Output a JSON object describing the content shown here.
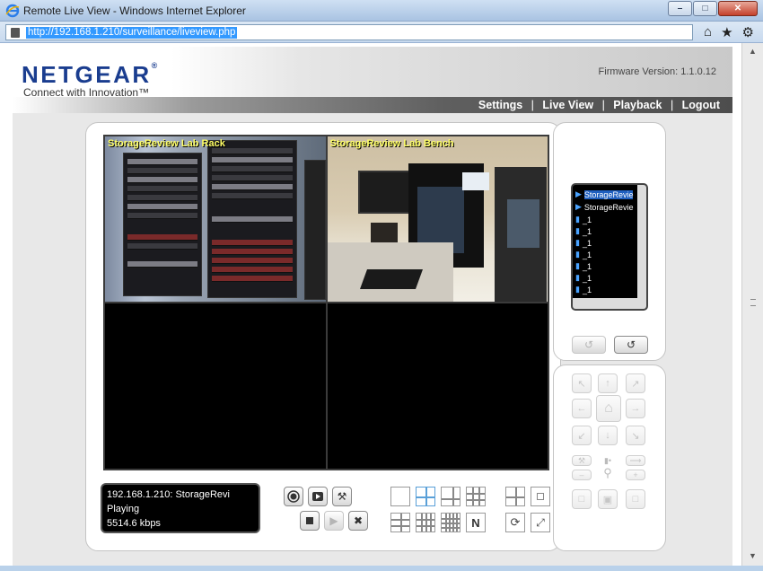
{
  "window": {
    "title": "Remote Live View - Windows Internet Explorer",
    "url": "http://192.168.1.210/surveillance/liveview.php"
  },
  "header": {
    "logo_text": "NETGEAR",
    "tagline": "Connect with Innovation™",
    "firmware": "Firmware Version: 1.1.0.12"
  },
  "nav": {
    "items": [
      "Settings",
      "Live View",
      "Playback",
      "Logout"
    ],
    "separator": "|"
  },
  "video": {
    "tiles": [
      {
        "label": "StorageReview Lab Rack",
        "state": "playing"
      },
      {
        "label": "StorageReview Lab Bench",
        "state": "playing"
      },
      {
        "label": "",
        "state": "empty"
      },
      {
        "label": "",
        "state": "empty"
      }
    ]
  },
  "status": {
    "line1": "192.168.1.210: StorageRevi",
    "line2": "Playing",
    "line3": "5514.6 kbps"
  },
  "camera_list": {
    "items": [
      {
        "label": "StorageRevie",
        "selected": true
      },
      {
        "label": "StorageRevie",
        "selected": false
      },
      {
        "label": "_1"
      },
      {
        "label": "_1"
      },
      {
        "label": "_1"
      },
      {
        "label": "_1"
      },
      {
        "label": "_1"
      },
      {
        "label": "_1"
      },
      {
        "label": "_1"
      }
    ]
  },
  "colors": {
    "brand": "#1a3d8f",
    "tile_label": "#ffff66",
    "active_tile_border": "#2e8b2e"
  }
}
